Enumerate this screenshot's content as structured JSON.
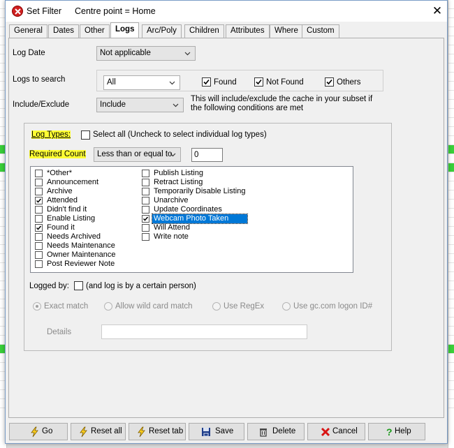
{
  "window": {
    "title": "Set Filter",
    "subtitle": "Centre point = Home",
    "close_glyph": "✕"
  },
  "tabs": [
    {
      "label": "General"
    },
    {
      "label": "Dates"
    },
    {
      "label": "Other"
    },
    {
      "label": "Logs",
      "active": true
    },
    {
      "label": "Arc/Poly"
    },
    {
      "label": "Children"
    },
    {
      "label": "Attributes"
    },
    {
      "label": "Where"
    },
    {
      "label": "Custom"
    }
  ],
  "logs": {
    "log_date": {
      "label": "Log Date",
      "value": "Not applicable"
    },
    "logs_to_search": {
      "label": "Logs to search",
      "value": "All",
      "found": {
        "label": "Found",
        "checked": true
      },
      "not_found": {
        "label": "Not Found",
        "checked": true
      },
      "others": {
        "label": "Others",
        "checked": true
      }
    },
    "include_exclude": {
      "label": "Include/Exclude",
      "value": "Include",
      "note": "This will include/exclude the cache in your subset if the following conditions are met"
    },
    "log_types": {
      "label": "Log Types:",
      "select_all_label": "Select all (Uncheck to select individual log types)",
      "select_all_checked": false
    },
    "required_count": {
      "label": "Required Count",
      "operator": "Less than or equal to",
      "value": "0"
    },
    "log_type_list_col1": [
      {
        "label": "*Other*",
        "checked": false
      },
      {
        "label": "Announcement",
        "checked": false
      },
      {
        "label": "Archive",
        "checked": false
      },
      {
        "label": "Attended",
        "checked": true
      },
      {
        "label": "Didn't find it",
        "checked": false
      },
      {
        "label": "Enable Listing",
        "checked": false
      },
      {
        "label": "Found it",
        "checked": true
      },
      {
        "label": "Needs Archived",
        "checked": false
      },
      {
        "label": "Needs Maintenance",
        "checked": false
      },
      {
        "label": "Owner Maintenance",
        "checked": false
      },
      {
        "label": "Post Reviewer Note",
        "checked": false
      }
    ],
    "log_type_list_col2": [
      {
        "label": "Publish Listing",
        "checked": false
      },
      {
        "label": "Retract Listing",
        "checked": false
      },
      {
        "label": "Temporarily Disable Listing",
        "checked": false
      },
      {
        "label": "Unarchive",
        "checked": false
      },
      {
        "label": "Update Coordinates",
        "checked": false
      },
      {
        "label": "Webcam Photo Taken",
        "checked": true,
        "selected": true
      },
      {
        "label": "Will Attend",
        "checked": false
      },
      {
        "label": "Write note",
        "checked": false
      }
    ],
    "logged_by": {
      "label": "Logged by:",
      "checkbox_label": "(and log is by a certain person)",
      "checked": false
    },
    "match_options": [
      {
        "label": "Exact match",
        "selected": true
      },
      {
        "label": "Allow wild card match",
        "selected": false
      },
      {
        "label": "Use RegEx",
        "selected": false
      },
      {
        "label": "Use gc.com logon ID#",
        "selected": false
      }
    ],
    "details": {
      "label": "Details",
      "value": ""
    }
  },
  "buttons": [
    {
      "label": "Go",
      "icon": "lightning-icon"
    },
    {
      "label": "Reset all",
      "icon": "lightning-icon"
    },
    {
      "label": "Reset tab",
      "icon": "lightning-icon"
    },
    {
      "label": "Save",
      "icon": "floppy-disk-icon"
    },
    {
      "label": "Delete",
      "icon": "trash-can-icon"
    },
    {
      "label": "Cancel",
      "icon": "red-x-icon"
    },
    {
      "label": "Help",
      "icon": "question-mark-icon"
    }
  ],
  "colors": {
    "highlight": "#ffff33",
    "selection": "#0078d7",
    "background_green": "#39d039"
  }
}
